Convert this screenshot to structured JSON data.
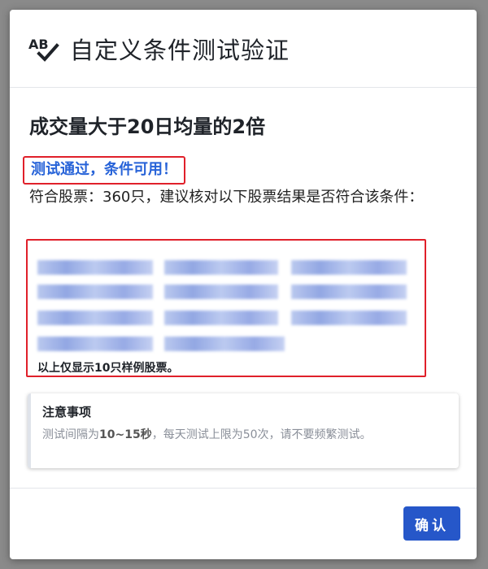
{
  "dialog": {
    "title": "自定义条件测试验证",
    "icon": "spell-check-icon",
    "condition_title": "成交量大于20日均量的2倍",
    "status_message": "测试通过，条件可用！",
    "summary": "符合股票：360只，建议核对以下股票结果是否符合该条件：",
    "sample_note": "以上仅显示10只样例股票。",
    "notice": {
      "title": "注意事项",
      "text_prefix": "测试间隔为",
      "text_interval": "10~15秒",
      "text_suffix": "，每天测试上限为50次，请不要频繁测试。"
    },
    "confirm_label": "确认"
  },
  "colors": {
    "accent": "#2657c9",
    "status_text": "#2763d8",
    "highlight_border": "#e0202a"
  }
}
